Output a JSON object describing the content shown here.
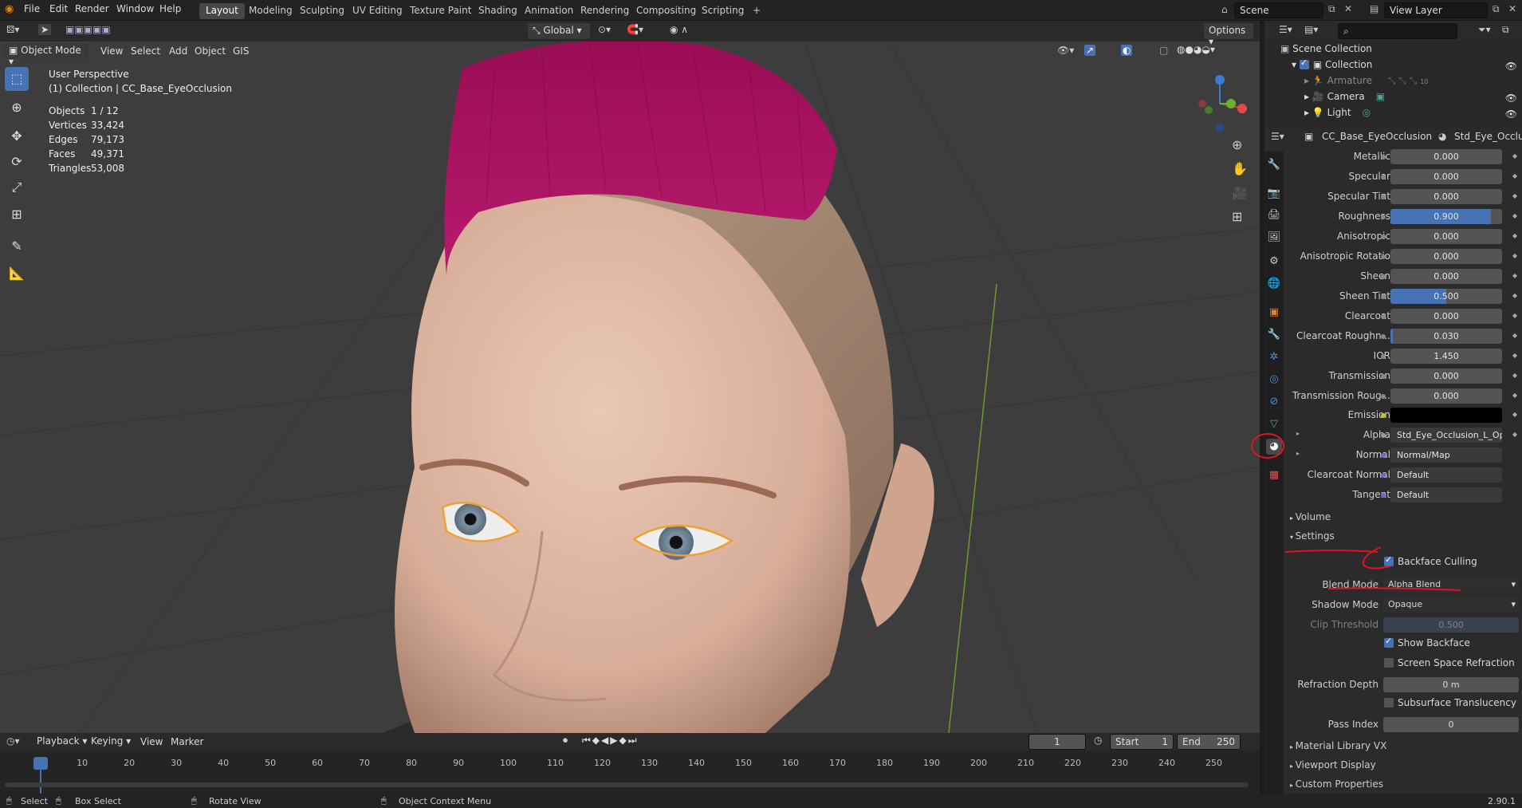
{
  "menu": [
    "File",
    "Edit",
    "Render",
    "Window",
    "Help"
  ],
  "workspaces": [
    "Layout",
    "Modeling",
    "Sculpting",
    "UV Editing",
    "Texture Paint",
    "Shading",
    "Animation",
    "Rendering",
    "Compositing",
    "Scripting"
  ],
  "workspace_add": "+",
  "scene_field": "Scene",
  "viewlayer_field": "View Layer",
  "orientation": "Global",
  "options_btn": "Options",
  "mode_btn": "Object Mode",
  "vp_menu": [
    "View",
    "Select",
    "Add",
    "Object",
    "GIS"
  ],
  "overlay": {
    "perspective": "User Perspective",
    "collection": "(1) Collection | CC_Base_EyeOcclusion",
    "stats": [
      {
        "label": "Objects",
        "value": "1 / 12"
      },
      {
        "label": "Vertices",
        "value": "33,424"
      },
      {
        "label": "Edges",
        "value": "79,173"
      },
      {
        "label": "Faces",
        "value": "49,371"
      },
      {
        "label": "Triangles",
        "value": "53,008"
      }
    ]
  },
  "outliner": {
    "search_placeholder": "",
    "items": [
      {
        "label": "Scene Collection"
      },
      {
        "label": "Collection"
      },
      {
        "label": "Armature"
      },
      {
        "label": "Camera"
      },
      {
        "label": "Light"
      }
    ],
    "armature_badge": "10"
  },
  "props": {
    "object_name": "CC_Base_EyeOcclusion",
    "material_name": "Std_Eye_Occlusi",
    "rows": [
      {
        "label": "Metallic",
        "value": "0.000",
        "fill": 0
      },
      {
        "label": "Specular",
        "value": "0.000",
        "fill": 0
      },
      {
        "label": "Specular Tint",
        "value": "0.000",
        "fill": 0
      },
      {
        "label": "Roughness",
        "value": "0.900",
        "fill": 0.9
      },
      {
        "label": "Anisotropic",
        "value": "0.000",
        "fill": 0
      },
      {
        "label": "Anisotropic Rotatio",
        "value": "0.000",
        "fill": 0
      },
      {
        "label": "Sheen",
        "value": "0.000",
        "fill": 0
      },
      {
        "label": "Sheen Tint",
        "value": "0.500",
        "fill": 0.5
      },
      {
        "label": "Clearcoat",
        "value": "0.000",
        "fill": 0
      },
      {
        "label": "Clearcoat Roughn...",
        "value": "0.030",
        "fill": 0.03
      },
      {
        "label": "IOR",
        "value": "1.450",
        "fill": 0
      },
      {
        "label": "Transmission",
        "value": "0.000",
        "fill": 0
      },
      {
        "label": "Transmission Roug...",
        "value": "0.000",
        "fill": 0
      }
    ],
    "emission_label": "Emission",
    "links": [
      {
        "label": "Alpha",
        "value": "Std_Eye_Occlusion_L_Opa..."
      },
      {
        "label": "Normal",
        "value": "Normal/Map"
      },
      {
        "label": "Clearcoat Normal",
        "value": "Default"
      },
      {
        "label": "Tangent",
        "value": "Default"
      }
    ],
    "volume_panel": "Volume",
    "settings_panel": "Settings",
    "backface_culling": "Backface Culling",
    "blend_mode_label": "Blend Mode",
    "blend_mode_value": "Alpha Blend",
    "shadow_mode_label": "Shadow Mode",
    "shadow_mode_value": "Opaque",
    "clip_label": "Clip Threshold",
    "clip_value": "0.500",
    "show_backface": "Show Backface",
    "ssr": "Screen Space Refraction",
    "refraction_label": "Refraction Depth",
    "refraction_value": "0 m",
    "sss": "Subsurface Translucency",
    "pass_label": "Pass Index",
    "pass_value": "0",
    "extra_panels": [
      "Material Library VX",
      "Viewport Display",
      "Custom Properties"
    ]
  },
  "timeline": {
    "menu": [
      "Playback",
      "Keying",
      "View",
      "Marker"
    ],
    "current_frame": "1",
    "start_label": "Start",
    "start_value": "1",
    "end_label": "End",
    "end_value": "250",
    "ticks": [
      "1",
      "10",
      "20",
      "30",
      "40",
      "50",
      "60",
      "70",
      "80",
      "90",
      "100",
      "110",
      "120",
      "130",
      "140",
      "150",
      "160",
      "170",
      "180",
      "190",
      "200",
      "210",
      "220",
      "230",
      "240",
      "250"
    ]
  },
  "status": {
    "select": "Select",
    "box_select": "Box Select",
    "rotate": "Rotate View",
    "context_menu": "Object Context Menu",
    "version": "2.90.1"
  },
  "colors": {
    "accent": "#4772b3",
    "hair": "#a0135e",
    "annotation": "#e0141e"
  }
}
